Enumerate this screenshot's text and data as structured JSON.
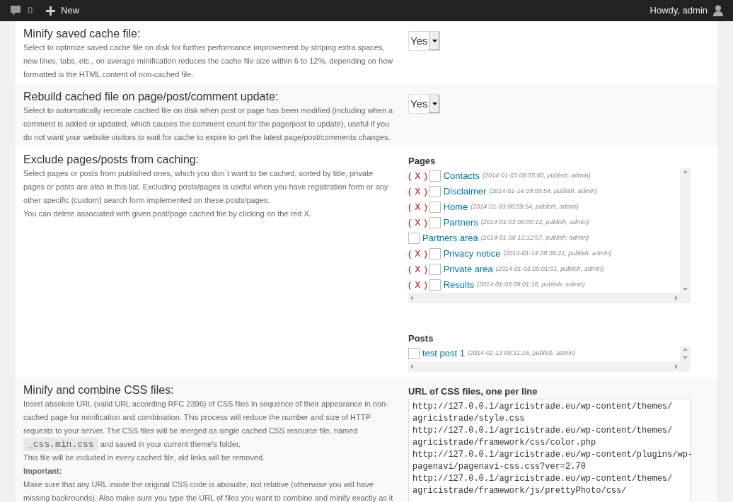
{
  "admin_bar": {
    "comments_count": "0",
    "new_label": "New",
    "greeting": "Howdy, admin"
  },
  "sections": [
    {
      "kind": "select",
      "title": "Minify saved cache file:",
      "description": [
        "Select to optimize saved cache file on disk for further performance improvement by striping extra spaces, new lines, tabs, etc., on average minification reduces the cache file size within 6 to 12%, depending on how formatted is the HTML content of non-cached file."
      ],
      "value": "Yes"
    },
    {
      "kind": "select",
      "title": "Rebuild cached file on page/post/comment update:",
      "description": [
        "Select to automatically recreate cached file on disk when post or page has been modified (including when a comment is added or updated, which causes the comment count for the page/post to update), useful if you do not want your website visitors to wait for cache to expire to get the latest page/post/comments changes."
      ],
      "value": "Yes"
    },
    {
      "kind": "exclude",
      "title": "Exclude pages/posts from caching:",
      "description": [
        "Select pages or posts from published ones, which you don`t want to be cached, sorted by title, private pages or posts are also in this list. Excluding posts/pages is useful when you have registration form or any other specific (custom) search form implemented on these posts/pages.",
        "You can delete associated with given post/page cached file by clicking on the red X."
      ],
      "lists": [
        {
          "heading": "Pages",
          "items": [
            {
              "delete_mark": "( X )",
              "checked": false,
              "title": "Contacts",
              "meta": "(2014-01-03 08:55:00, publish, admin)"
            },
            {
              "delete_mark": "( X )",
              "checked": false,
              "title": "Disclaimer",
              "meta": "(2014-01-14 09:59:54, publish, admin)"
            },
            {
              "delete_mark": "( X )",
              "checked": false,
              "title": "Home",
              "meta": "(2014-01-03 08:59:54, publish, admin)"
            },
            {
              "delete_mark": "( X )",
              "checked": false,
              "title": "Partners",
              "meta": "(2014-01-03 09:00:12, publish, admin)"
            },
            {
              "checked": false,
              "title": "Partners area",
              "meta": "(2014-01-08 13:12:57, publish, admin)"
            },
            {
              "delete_mark": "( X )",
              "checked": false,
              "title": "Privacy notice",
              "meta": "(2014-01-14 09:56:21, publish, admin)"
            },
            {
              "delete_mark": "( X )",
              "checked": false,
              "title": "Private area",
              "meta": "(2014-01-03 09:01:01, publish, admin)"
            },
            {
              "delete_mark": "( X )",
              "checked": false,
              "title": "Results",
              "meta": "(2014-01-03 09:01:16, publish, admin)"
            }
          ]
        },
        {
          "heading": "Posts",
          "items": [
            {
              "checked": false,
              "title": "test post 1",
              "meta": "(2014-02-13 09:31:16, publish, admin)"
            }
          ]
        }
      ]
    },
    {
      "kind": "css",
      "title": "Minify and combine CSS files:",
      "intro_before": "Insert absolute URL (valid URL according RFC 2396) of CSS files in sequence of their appearance in non-cached page for minification and combination. This process will reduce the number and size of HTTP requests to your server. The CSS files will be merged as single cached CSS resource file, named",
      "code": "_css.min.css",
      "intro_after": "and saved in your current theme's folder.",
      "note": "This file will be included in every cached file, old links will be removed.",
      "important_label": "Important:",
      "important_text": "Make sure that any URL inside the original CSS code is abosulte, not relative (otherwise you will have missing backrounds). Also make sure you type the URL of files you want to combine and minify exactly as it",
      "field_label": "URL of CSS files, one per line",
      "field_lines": [
        "http://127.0.0.1/agricistrade.eu/wp-content/themes/",
        "agricistrade/style.css",
        "http://127.0.0.1/agricistrade.eu/wp-content/themes/",
        "agricistrade/framework/css/color.php",
        "http://127.0.0.1/agricistrade.eu/wp-content/plugins/wp-",
        "pagenavi/pagenavi-css.css?ver=2.70",
        "http://127.0.0.1/agricistrade.eu/wp-content/themes/",
        "agricistrade/framework/js/prettyPhoto/css/"
      ]
    }
  ]
}
